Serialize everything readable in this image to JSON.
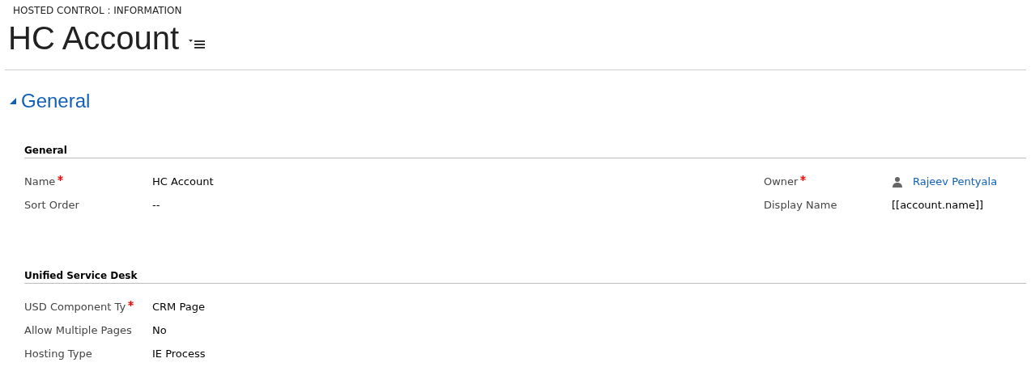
{
  "breadcrumb": "HOSTED CONTROL : INFORMATION",
  "title": "HC Account",
  "tab": {
    "label": "General",
    "expanded": true
  },
  "sections": [
    {
      "heading": "General",
      "columns": [
        [
          {
            "label": "Name",
            "required": true,
            "value": "HC Account",
            "kind": "text"
          },
          {
            "label": "Sort Order",
            "required": false,
            "value": "--",
            "kind": "text"
          }
        ],
        [
          {
            "label": "Owner",
            "required": true,
            "value": "Rajeev Pentyala",
            "kind": "lookup"
          },
          {
            "label": "Display Name",
            "required": false,
            "value": "[[account.name]]",
            "kind": "text"
          }
        ]
      ]
    },
    {
      "heading": "Unified Service Desk",
      "columns": [
        [
          {
            "label": "USD Component Ty",
            "required": true,
            "value": "CRM Page",
            "kind": "text"
          },
          {
            "label": "Allow Multiple Pages",
            "required": false,
            "value": "No",
            "kind": "text"
          },
          {
            "label": "Hosting Type",
            "required": false,
            "value": "IE Process",
            "kind": "text"
          }
        ]
      ]
    }
  ]
}
